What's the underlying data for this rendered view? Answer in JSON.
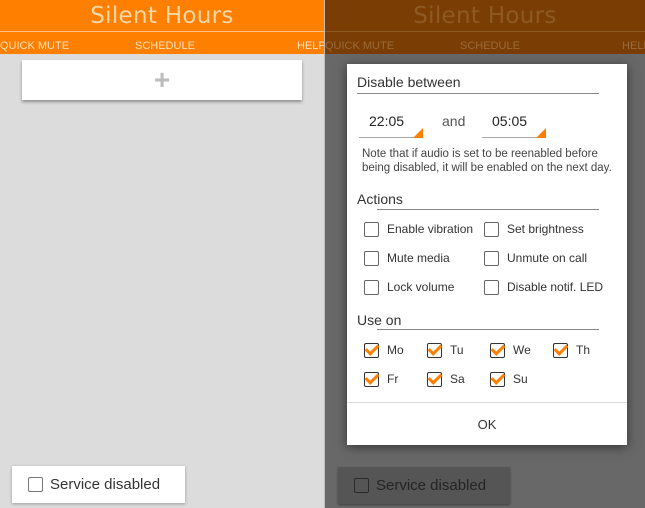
{
  "colors": {
    "accent": "#ff7f00",
    "header_dim": "#7a3d04",
    "background": "#dcdcdc",
    "overlay": "#686868"
  },
  "app": {
    "title": "Silent Hours",
    "tabs": [
      "QUICK MUTE",
      "SCHEDULE",
      "HELP"
    ]
  },
  "main": {
    "add_icon": "plus-icon",
    "add_symbol": "+"
  },
  "service": {
    "label": "Service disabled",
    "checked": false
  },
  "dialog": {
    "disable_between_label": "Disable between",
    "start_time": "22:05",
    "and_label": "and",
    "end_time": "05:05",
    "note": "Note that if audio is set to be reenabled before being disabled, it will be enabled on the next day.",
    "actions_label": "Actions",
    "actions": [
      {
        "label": "Enable vibration",
        "checked": false
      },
      {
        "label": "Set brightness",
        "checked": false
      },
      {
        "label": "Mute media",
        "checked": false
      },
      {
        "label": "Unmute on call",
        "checked": false
      },
      {
        "label": "Lock volume",
        "checked": false
      },
      {
        "label": "Disable notif. LED",
        "checked": false
      }
    ],
    "use_on_label": "Use on",
    "days": [
      {
        "label": "Mo",
        "checked": true
      },
      {
        "label": "Tu",
        "checked": true
      },
      {
        "label": "We",
        "checked": true
      },
      {
        "label": "Th",
        "checked": true
      },
      {
        "label": "Fr",
        "checked": true
      },
      {
        "label": "Sa",
        "checked": true
      },
      {
        "label": "Su",
        "checked": true
      }
    ],
    "ok_label": "OK"
  }
}
